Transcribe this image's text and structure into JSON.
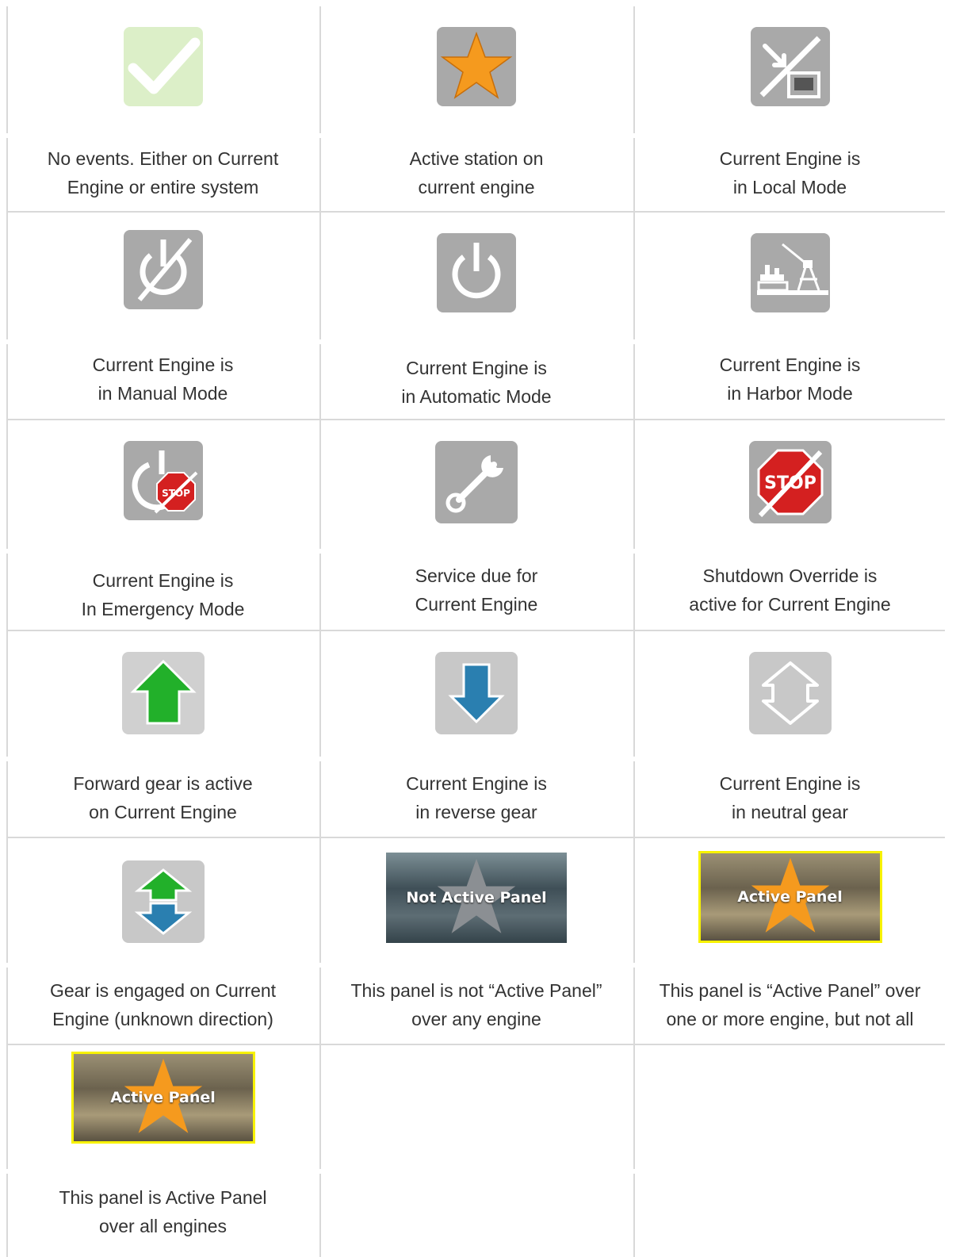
{
  "cells": [
    {
      "icon": "checkmark-icon",
      "lines": [
        "No events. Either on Current",
        "Engine or entire system"
      ]
    },
    {
      "icon": "star-icon",
      "lines": [
        "Active station on",
        "current engine"
      ]
    },
    {
      "icon": "local-mode-icon",
      "lines": [
        "Current Engine is",
        "in Local Mode"
      ]
    },
    {
      "icon": "manual-mode-icon",
      "lines": [
        "Current Engine is",
        "in Manual Mode"
      ]
    },
    {
      "icon": "power-icon",
      "lines": [
        "Current Engine is",
        "in Automatic Mode"
      ]
    },
    {
      "icon": "harbor-crane-icon",
      "lines": [
        "Current Engine is",
        "in Harbor Mode"
      ]
    },
    {
      "icon": "emergency-stop-icon",
      "lines": [
        "Current Engine is",
        "In Emergency Mode"
      ],
      "stop_text": "STOP"
    },
    {
      "icon": "wrench-icon",
      "lines": [
        "Service due for",
        "Current Engine"
      ]
    },
    {
      "icon": "stop-override-icon",
      "lines": [
        "Shutdown Override is",
        "active for Current Engine"
      ],
      "stop_text": "STOP"
    },
    {
      "icon": "arrow-up-icon",
      "lines": [
        "Forward gear is active",
        "on Current Engine"
      ]
    },
    {
      "icon": "arrow-down-icon",
      "lines": [
        "Current Engine is",
        "in reverse gear"
      ]
    },
    {
      "icon": "neutral-arrows-icon",
      "lines": [
        "Current Engine is",
        "in neutral gear"
      ]
    },
    {
      "icon": "gear-engaged-icon",
      "lines": [
        "Gear is engaged on Current",
        "Engine (unknown direction)"
      ]
    },
    {
      "icon": "not-active-panel-badge",
      "badge_text": "Not Active Panel",
      "lines": [
        "This panel is not “Active Panel”",
        "over any engine"
      ]
    },
    {
      "icon": "active-panel-badge",
      "badge_text": "Active Panel",
      "lines": [
        "This panel is “Active Panel” over",
        "one or more engine, but not all"
      ]
    },
    {
      "icon": "active-panel-badge",
      "badge_text": "Active Panel",
      "lines": [
        "This panel is Active Panel",
        "over all engines"
      ]
    }
  ],
  "colors": {
    "grid_line": "#d9d9d9",
    "icon_bg": "#a9a9a9",
    "check_bg": "#dcefc8",
    "star": "#f59a1e",
    "stop_red": "#d42020",
    "forward_green": "#22b02a",
    "reverse_blue": "#2a7fb0",
    "active_border": "#f7f200"
  }
}
